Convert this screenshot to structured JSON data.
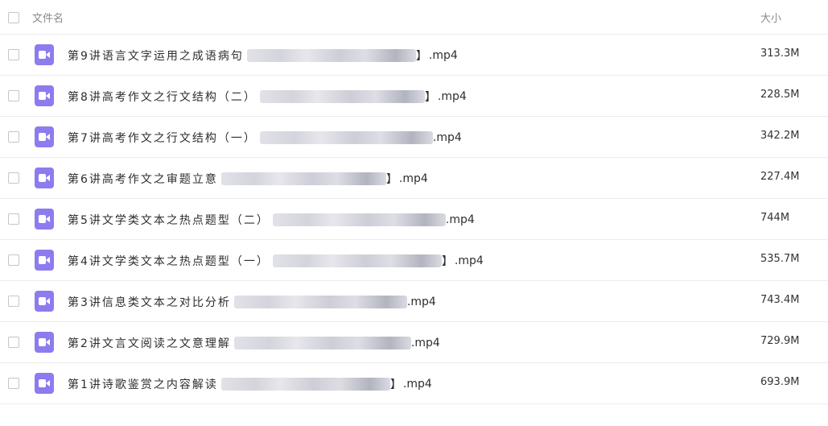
{
  "header": {
    "name_label": "文件名",
    "size_label": "大小"
  },
  "rows": [
    {
      "title": "第9讲语言文字运用之成语病句",
      "bracket": "】",
      "ext": ".mp4",
      "size": "313.3M"
    },
    {
      "title": "第8讲高考作文之行文结构（二）",
      "bracket": "】",
      "ext": ".mp4",
      "size": "228.5M"
    },
    {
      "title": "第7讲高考作文之行文结构（一）",
      "bracket": "",
      "ext": ".mp4",
      "size": "342.2M"
    },
    {
      "title": "第6讲高考作文之审题立意",
      "bracket": "】",
      "ext": ".mp4",
      "size": "227.4M"
    },
    {
      "title": "第5讲文学类文本之热点题型（二）",
      "bracket": "",
      "ext": ".mp4",
      "size": "744M"
    },
    {
      "title": "第4讲文学类文本之热点题型（一）",
      "bracket": "】",
      "ext": ".mp4",
      "size": "535.7M"
    },
    {
      "title": "第3讲信息类文本之对比分析",
      "bracket": "",
      "ext": ".mp4",
      "size": "743.4M"
    },
    {
      "title": "第2讲文言文阅读之文意理解",
      "bracket": "",
      "ext": ".mp4",
      "size": "729.9M"
    },
    {
      "title": "第1讲诗歌鉴赏之内容解读",
      "bracket": "】",
      "ext": ".mp4",
      "size": "693.9M"
    }
  ],
  "icon": {
    "name": "video-file-icon",
    "color": "#8c7cf0"
  }
}
